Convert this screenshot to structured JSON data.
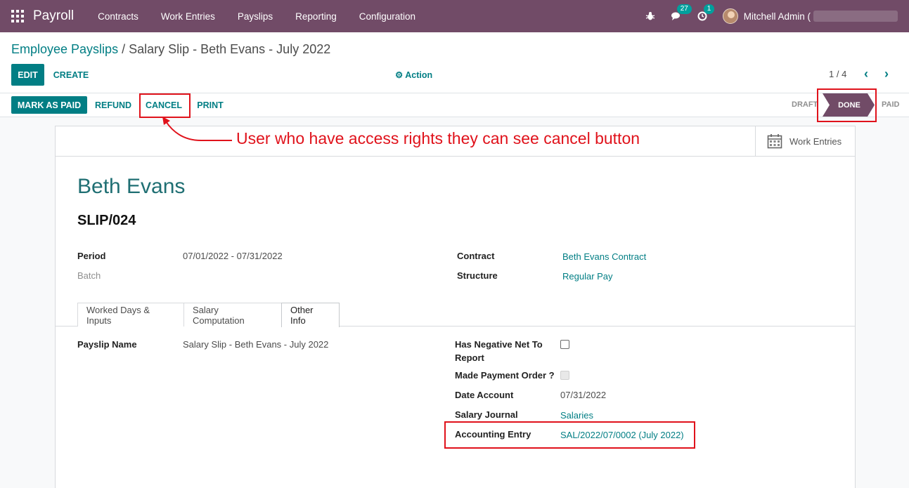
{
  "navbar": {
    "brand": "Payroll",
    "menu": [
      "Contracts",
      "Work Entries",
      "Payslips",
      "Reporting",
      "Configuration"
    ],
    "messages_count": "27",
    "activities_count": "1",
    "user_name": "Mitchell Admin ("
  },
  "breadcrumb": {
    "parent": "Employee Payslips",
    "separator": " / ",
    "current": "Salary Slip - Beth Evans - July 2022"
  },
  "control": {
    "edit": "EDIT",
    "create": "CREATE",
    "action": "Action",
    "pager": "1 / 4"
  },
  "statusbar": {
    "buttons": [
      "MARK AS PAID",
      "REFUND",
      "CANCEL",
      "PRINT"
    ],
    "stages": [
      "DRAFT",
      "DONE",
      "PAID"
    ],
    "active_stage": "DONE"
  },
  "annotation": {
    "text": "User who have access rights they can see cancel button",
    "color": "#e0121b"
  },
  "smart_button": {
    "label": "Work Entries",
    "icon": "calendar-icon"
  },
  "form": {
    "employee": "Beth Evans",
    "reference": "SLIP/024",
    "period_label": "Period",
    "period_value": "07/01/2022 - 07/31/2022",
    "batch_label": "Batch",
    "contract_label": "Contract",
    "contract_value": "Beth Evans Contract",
    "structure_label": "Structure",
    "structure_value": "Regular Pay"
  },
  "tabs": [
    "Worked Days & Inputs",
    "Salary Computation",
    "Other Info"
  ],
  "active_tab": "Other Info",
  "other_info": {
    "payslip_name_label": "Payslip Name",
    "payslip_name_value": "Salary Slip - Beth Evans - July 2022",
    "negative_net_label_1": "Has Negative Net To",
    "negative_net_label_2": "Report",
    "negative_net_checked": false,
    "payment_order_label": "Made Payment Order ?",
    "payment_order_checked": false,
    "date_account_label": "Date Account",
    "date_account_value": "07/31/2022",
    "salary_journal_label": "Salary Journal",
    "salary_journal_value": "Salaries",
    "accounting_entry_label": "Accounting Entry",
    "accounting_entry_value": "SAL/2022/07/0002 (July 2022)"
  },
  "colors": {
    "brand": "#714b67",
    "accent": "#017e84",
    "annotation": "#e0121b"
  }
}
